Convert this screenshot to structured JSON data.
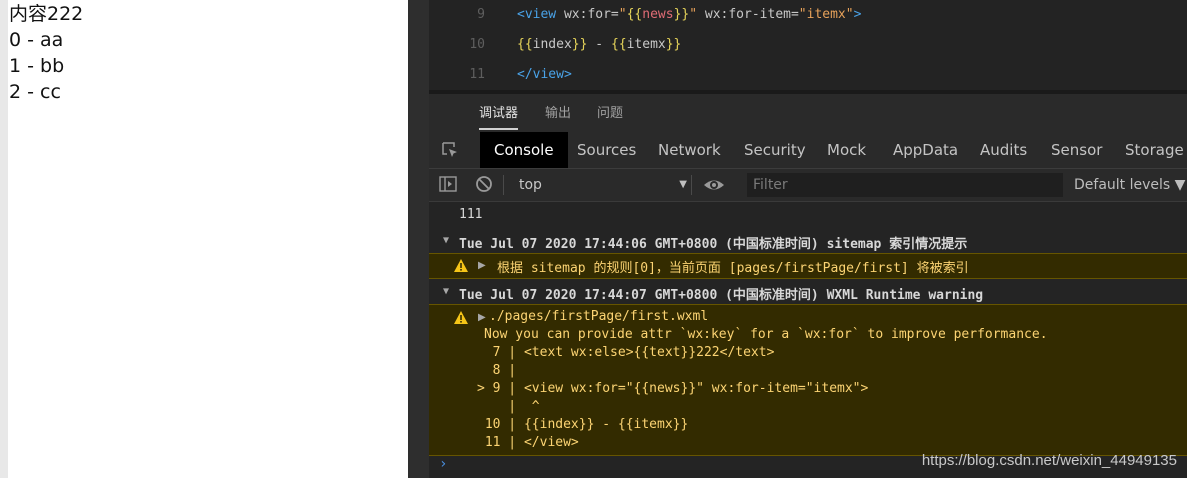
{
  "simulator": {
    "lines": [
      "内容222",
      "0 - aa",
      "1 - bb",
      "2 - cc"
    ]
  },
  "editor": {
    "line_numbers": [
      "9",
      "10",
      "11"
    ],
    "line9": {
      "open": "<view ",
      "attr1": "wx:for=",
      "q1": "\"",
      "m1": "{{",
      "v1": "news",
      "m2": "}}",
      "q2": "\"",
      "attr2": " wx:for-item=",
      "v2": "\"itemx\"",
      "close": ">"
    },
    "line10": {
      "m1": "{{",
      "v1": "index",
      "m2": "}}",
      "sep": " - ",
      "m3": "{{",
      "v2": "itemx",
      "m4": "}}"
    },
    "line11": "</view>"
  },
  "panel_tabs": [
    "调试器",
    "输出",
    "问题"
  ],
  "devtools_tabs": [
    "Console",
    "Sources",
    "Network",
    "Security",
    "Mock",
    "AppData",
    "Audits",
    "Sensor",
    "Storage"
  ],
  "toolbar": {
    "context": "top",
    "filter_placeholder": "Filter",
    "levels": "Default levels ▼"
  },
  "console": {
    "log1": "111",
    "group1": "Tue Jul 07 2020 17:44:06 GMT+0800 (中国标准时间) sitemap 索引情况提示",
    "warn1": "根据 sitemap 的规则[0]，当前页面 [pages/firstPage/first] 将被索引",
    "group2": "Tue Jul 07 2020 17:44:07 GMT+0800 (中国标准时间) WXML Runtime warning",
    "warn2_file": "./pages/firstPage/first.wxml",
    "warn2_msg": "Now you can provide attr `wx:key` for a `wx:for` to improve performance.",
    "code_lines": [
      "  7 | <text wx:else>{{text}}222</text>",
      "  8 |",
      "> 9 | <view wx:for=\"{{news}}\" wx:for-item=\"itemx\">",
      "    |  ^",
      " 10 | {{index}} - {{itemx}}",
      " 11 | </view>"
    ],
    "prompt": "›"
  },
  "watermark": "https://blog.csdn.net/weixin_44949135",
  "icons": {
    "inspect": "inspect-element-icon",
    "sidebar": "sidebar-toggle-icon",
    "clear": "clear-console-icon",
    "eye": "live-expression-eye-icon",
    "warning": "warning-icon"
  }
}
